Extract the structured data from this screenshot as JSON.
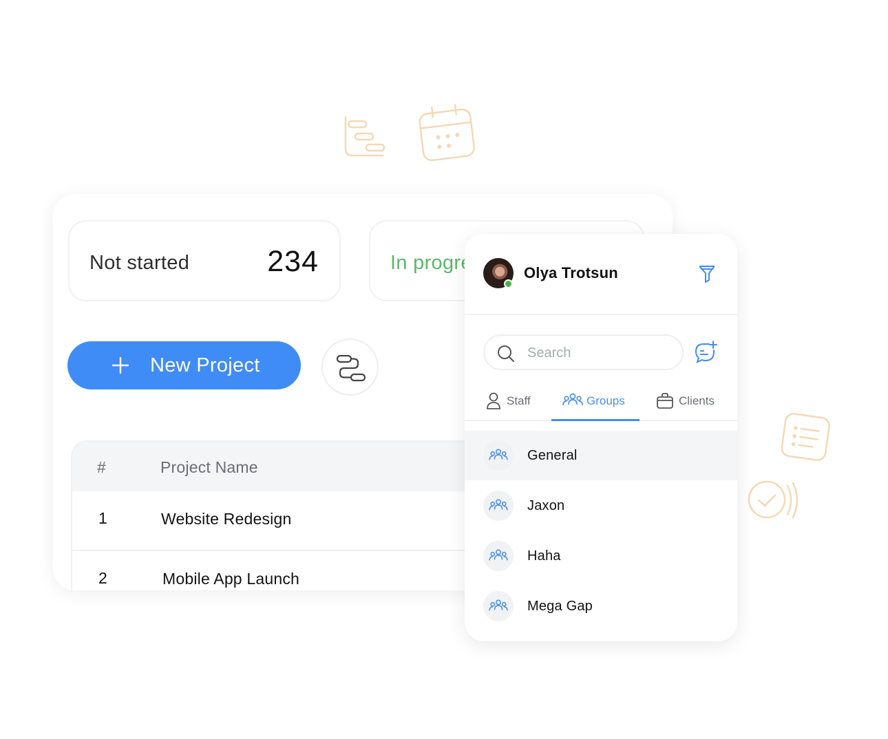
{
  "stats": [
    {
      "label": "Not started",
      "value": "234"
    },
    {
      "label": "In progre"
    }
  ],
  "actions": {
    "new_project_label": "New Project"
  },
  "table": {
    "columns": [
      "#",
      "Project Name"
    ],
    "rows": [
      {
        "num": "1",
        "name": "Website Redesign"
      },
      {
        "num": "2",
        "name": "Mobile App Launch"
      }
    ]
  },
  "chat": {
    "user_name": "Olya Trotsun",
    "user_status": "online",
    "search_placeholder": "Search",
    "tabs": [
      {
        "label": "Staff",
        "icon": "user-icon"
      },
      {
        "label": "Groups",
        "icon": "users-icon",
        "active": true
      },
      {
        "label": "Clients",
        "icon": "briefcase-icon"
      }
    ],
    "groups": [
      {
        "name": "General",
        "selected": true
      },
      {
        "name": "Jaxon"
      },
      {
        "name": "Haha"
      },
      {
        "name": "Mega Gap"
      }
    ]
  },
  "colors": {
    "accent": "#3f8cf7",
    "in_progress": "#5cb86a",
    "status_online": "#4caf50",
    "decor_orange": "#f6d8b4"
  }
}
